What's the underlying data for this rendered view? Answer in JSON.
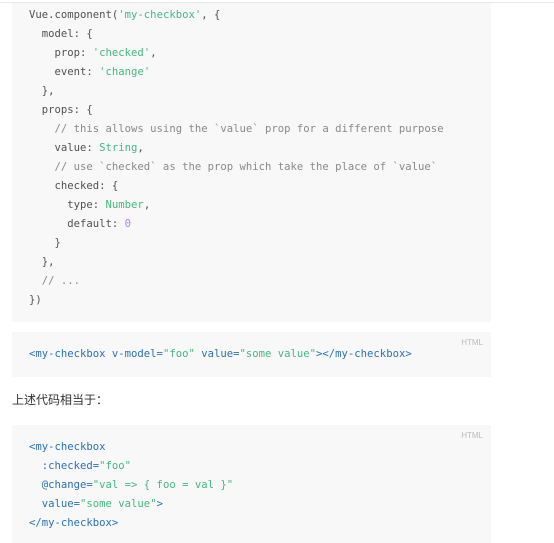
{
  "code_blocks": [
    {
      "language": "",
      "lines": [
        [
          {
            "t": "Vue.component(",
            "c": ""
          },
          {
            "t": "'my-checkbox'",
            "c": "s"
          },
          {
            "t": ", {",
            "c": ""
          }
        ],
        [
          {
            "t": "  model: {",
            "c": ""
          }
        ],
        [
          {
            "t": "    prop: ",
            "c": ""
          },
          {
            "t": "'checked'",
            "c": "s"
          },
          {
            "t": ",",
            "c": ""
          }
        ],
        [
          {
            "t": "    event: ",
            "c": ""
          },
          {
            "t": "'change'",
            "c": "s"
          }
        ],
        [
          {
            "t": "  },",
            "c": ""
          }
        ],
        [
          {
            "t": "  props: {",
            "c": ""
          }
        ],
        [
          {
            "t": "    // this allows using the `value` prop for a different purpose",
            "c": "c"
          }
        ],
        [
          {
            "t": "    value: ",
            "c": ""
          },
          {
            "t": "String",
            "c": "s"
          },
          {
            "t": ",",
            "c": ""
          }
        ],
        [
          {
            "t": "    // use `checked` as the prop which take the place of `value`",
            "c": "c"
          }
        ],
        [
          {
            "t": "    checked: {",
            "c": ""
          }
        ],
        [
          {
            "t": "      type: ",
            "c": ""
          },
          {
            "t": "Number",
            "c": "s"
          },
          {
            "t": ",",
            "c": ""
          }
        ],
        [
          {
            "t": "      default: ",
            "c": ""
          },
          {
            "t": "0",
            "c": "n"
          }
        ],
        [
          {
            "t": "    }",
            "c": ""
          }
        ],
        [
          {
            "t": "  },",
            "c": ""
          }
        ],
        [
          {
            "t": "  // ...",
            "c": "c"
          }
        ],
        [
          {
            "t": "})",
            "c": ""
          }
        ]
      ]
    },
    {
      "language": "HTML",
      "lines": [
        [
          {
            "t": "<my-checkbox v-model=",
            "c": "t"
          },
          {
            "t": "\"foo\"",
            "c": "s"
          },
          {
            "t": " value=",
            "c": "t"
          },
          {
            "t": "\"some value\"",
            "c": "s"
          },
          {
            "t": "></my-checkbox>",
            "c": "t"
          }
        ]
      ]
    },
    {
      "language": "HTML",
      "lines": [
        [
          {
            "t": "<my-checkbox",
            "c": "t"
          }
        ],
        [
          {
            "t": "  :checked=",
            "c": "t"
          },
          {
            "t": "\"foo\"",
            "c": "s"
          }
        ],
        [
          {
            "t": "  @change=",
            "c": "t"
          },
          {
            "t": "\"val => { foo = val }\"",
            "c": "s"
          }
        ],
        [
          {
            "t": "  value=",
            "c": "t"
          },
          {
            "t": "\"some value\"",
            "c": "s"
          },
          {
            "t": ">",
            "c": "t"
          }
        ],
        [
          {
            "t": "</my-checkbox>",
            "c": "t"
          }
        ]
      ]
    }
  ],
  "paragraph": "上述代码相当于：",
  "colors": {
    "string": "#42b983",
    "number": "#ae81ff",
    "tag": "#2973b7",
    "text": "#525252",
    "code_bg": "#f8f8f8"
  }
}
